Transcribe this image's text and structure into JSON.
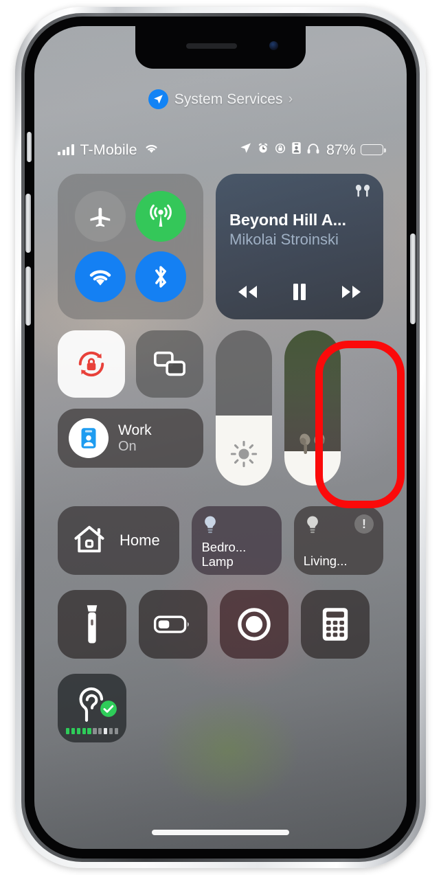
{
  "device": {
    "name": "iphone-x-frame"
  },
  "overlay": {
    "highlight_color": "#fb0a0a",
    "highlight_target": "volume-slider"
  },
  "system_services": {
    "label": "System Services",
    "chevron": "›",
    "icon": "location-arrow-icon",
    "icon_color": "#1283f5"
  },
  "status_bar": {
    "carrier": "T-Mobile",
    "signal_bars": 4,
    "wifi_icon": "wifi-icon",
    "icons": [
      "location-arrow-icon",
      "alarm-clock-icon",
      "rotation-lock-icon",
      "focus-badge-icon",
      "headphones-icon"
    ],
    "battery_percent": "87%",
    "battery_level": 87
  },
  "connectivity": {
    "toggles": [
      {
        "name": "airplane-mode",
        "icon": "airplane-icon",
        "state": "off",
        "color": "#a0a0a0"
      },
      {
        "name": "cellular-data",
        "icon": "cellular-icon",
        "state": "on",
        "color": "#34c759"
      },
      {
        "name": "wifi",
        "icon": "wifi-icon",
        "state": "on",
        "color": "#1480f3"
      },
      {
        "name": "bluetooth",
        "icon": "bluetooth-icon",
        "state": "on",
        "color": "#1480f3"
      }
    ]
  },
  "media_player": {
    "title": "Beyond Hill A...",
    "artist": "Mikolai Stroinski",
    "route_icon": "airpods-icon",
    "controls": [
      {
        "name": "rewind-button",
        "icon": "rewind-icon"
      },
      {
        "name": "pause-button",
        "icon": "pause-icon"
      },
      {
        "name": "fast-forward-button",
        "icon": "fast-forward-icon"
      }
    ],
    "playback_state": "playing"
  },
  "quick_toggles": {
    "rotation_lock": {
      "name": "rotation-lock",
      "state": "on",
      "icon": "rotation-lock-icon",
      "color": "#e8413a"
    },
    "screen_mirroring": {
      "name": "screen-mirroring",
      "state": "off",
      "icon": "screen-mirroring-icon"
    }
  },
  "focus": {
    "name": "Work",
    "state": "On",
    "icon": "work-badge-icon",
    "icon_color": "#1e9cf0"
  },
  "sliders": [
    {
      "name": "brightness-slider",
      "icon": "brightness-icon",
      "level": 45
    },
    {
      "name": "volume-slider",
      "icon": "airpods-icon",
      "level": 22
    }
  ],
  "home_controls": {
    "home_tile": {
      "label": "Home",
      "icon": "home-icon"
    },
    "accessories": [
      {
        "name": "bedroom-lamp",
        "label": "Bedro...\nLamp",
        "label_line1": "Bedro...",
        "label_line2": "Lamp",
        "icon": "lightbulb-icon",
        "warning": false
      },
      {
        "name": "living-room-light",
        "label": "Living...",
        "label_line1": "Living...",
        "label_line2": "",
        "icon": "lightbulb-icon",
        "warning": true,
        "warning_glyph": "!"
      }
    ]
  },
  "utilities": [
    {
      "name": "flashlight",
      "icon": "flashlight-icon"
    },
    {
      "name": "low-power-mode",
      "icon": "battery-icon"
    },
    {
      "name": "screen-record",
      "icon": "record-icon"
    },
    {
      "name": "calculator",
      "icon": "calculator-icon"
    }
  ],
  "hearing": {
    "name": "hearing-control",
    "icon": "ear-icon",
    "check_icon": "checkmark-icon",
    "check_color": "#2ecc59",
    "meter_active": 5,
    "meter_total": 10
  }
}
